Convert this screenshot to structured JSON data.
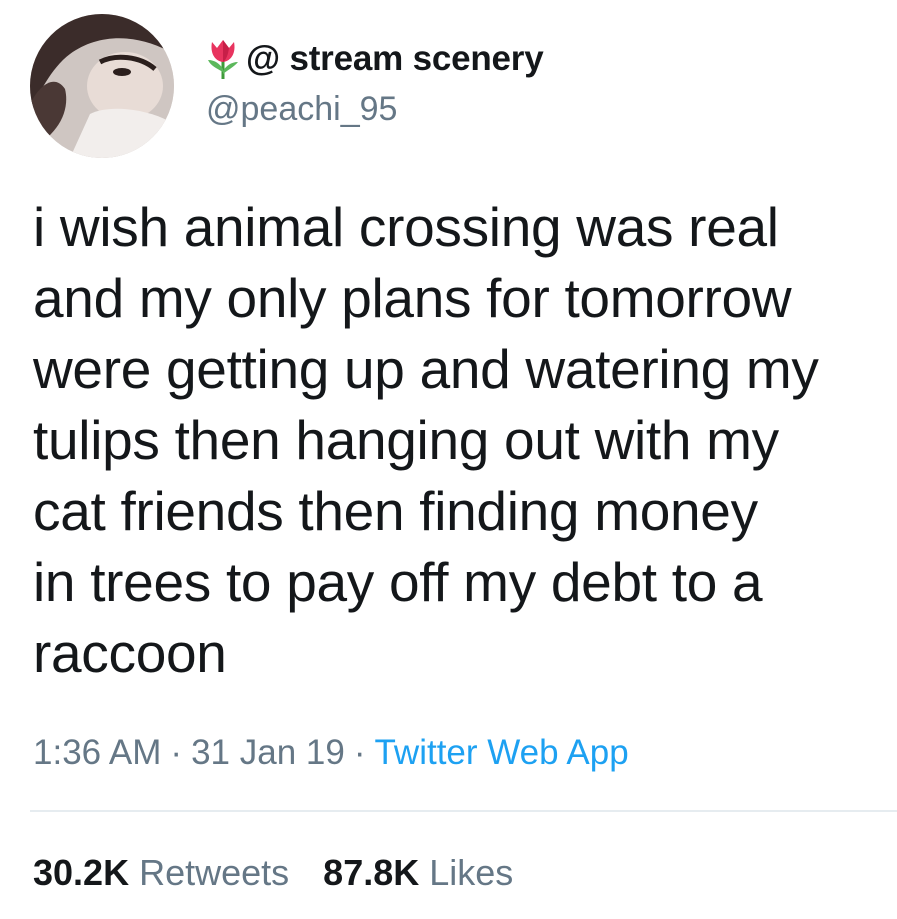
{
  "user": {
    "display_name": "@ stream scenery",
    "handle": "@peachi_95",
    "name_icon": "tulip-icon",
    "avatar_icon": "profile-photo"
  },
  "tweet": {
    "lines": [
      "i wish animal crossing was real",
      "and my only plans for tomorrow",
      "were getting up and watering my",
      "tulips then hanging out with my",
      "cat friends then finding money",
      "in trees to pay off my debt to a",
      "raccoon"
    ]
  },
  "meta": {
    "time": "1:36 AM",
    "date": "31 Jan 19",
    "separator": "·",
    "source": "Twitter Web App"
  },
  "stats": {
    "retweets_count": "30.2K",
    "retweets_label": "Retweets",
    "likes_count": "87.8K",
    "likes_label": "Likes"
  },
  "colors": {
    "text": "#14171a",
    "secondary": "#657786",
    "link": "#1da1f2",
    "divider": "#e6ecf0"
  }
}
